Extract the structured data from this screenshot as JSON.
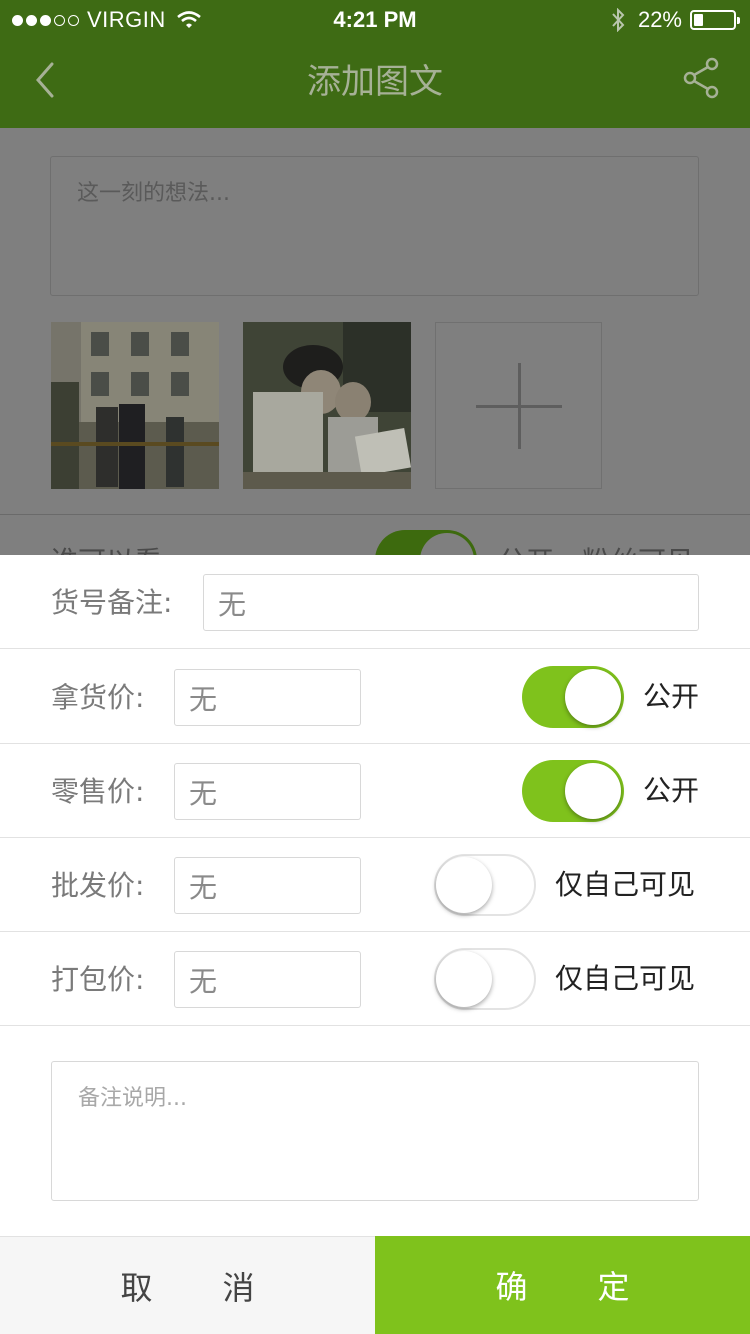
{
  "status_bar": {
    "carrier": "VIRGIN",
    "time": "4:21 PM",
    "battery_percent": "22%",
    "signal_bars": 3,
    "battery_level": 0.22
  },
  "nav": {
    "title": "添加图文",
    "back_icon": "chevron-left-icon",
    "share_icon": "share-icon"
  },
  "background": {
    "thought_placeholder": "这一刻的想法...",
    "row_label": "谁可以看",
    "row_right_text": "公开，粉丝可见"
  },
  "sheet": {
    "item_note": {
      "label": "货号备注:",
      "value": "无"
    },
    "prices": [
      {
        "label": "拿货价:",
        "value": "无",
        "toggle_on": true,
        "toggle_label": "公开"
      },
      {
        "label": "零售价:",
        "value": "无",
        "toggle_on": true,
        "toggle_label": "公开"
      },
      {
        "label": "批发价:",
        "value": "无",
        "toggle_on": false,
        "toggle_label": "仅自己可见"
      },
      {
        "label": "打包价:",
        "value": "无",
        "toggle_on": false,
        "toggle_label": "仅自己可见"
      }
    ],
    "remark_placeholder": "备注说明...",
    "cancel_label": "取消",
    "confirm_label": "确定"
  },
  "colors": {
    "header_green": "#3e6b14",
    "accent_green": "#7fc21c",
    "overlay_gray": "#7f7f7f"
  }
}
